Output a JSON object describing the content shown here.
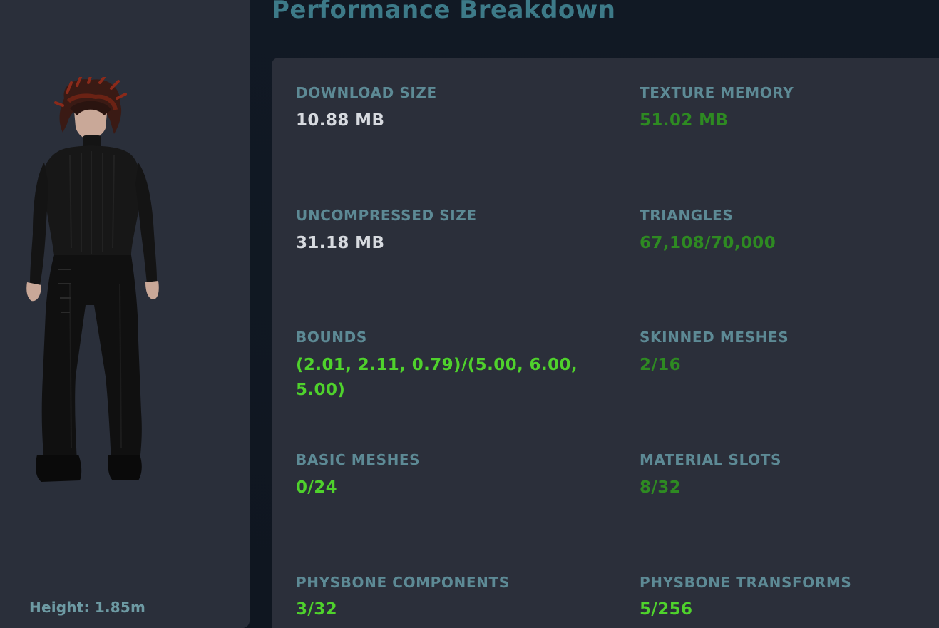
{
  "header": {
    "title": "Performance Breakdown"
  },
  "avatar": {
    "height_label": "Height: 1.85m"
  },
  "stats": [
    {
      "label": "DOWNLOAD SIZE",
      "value": "10.88 MB",
      "status": "neutral"
    },
    {
      "label": "TEXTURE MEMORY",
      "value": "51.02 MB",
      "status": "good"
    },
    {
      "label": "UNCOMPRESSED SIZE",
      "value": "31.18 MB",
      "status": "neutral"
    },
    {
      "label": "TRIANGLES",
      "value": "67,108/70,000",
      "status": "good"
    },
    {
      "label": "BOUNDS",
      "value": "(2.01, 2.11, 0.79)/(5.00, 6.00, 5.00)",
      "status": "excellent"
    },
    {
      "label": "SKINNED MESHES",
      "value": "2/16",
      "status": "good"
    },
    {
      "label": "BASIC MESHES",
      "value": "0/24",
      "status": "excellent"
    },
    {
      "label": "MATERIAL SLOTS",
      "value": "8/32",
      "status": "good"
    },
    {
      "label": "PHYSBONE COMPONENTS",
      "value": "3/32",
      "status": "excellent"
    },
    {
      "label": "PHYSBONE TRANSFORMS",
      "value": "5/256",
      "status": "excellent"
    }
  ],
  "colors": {
    "neutral": "#d7dadf",
    "good": "#2e8a22",
    "excellent": "#4fd22c",
    "label": "#5d8a95",
    "title": "#3d7a88"
  }
}
